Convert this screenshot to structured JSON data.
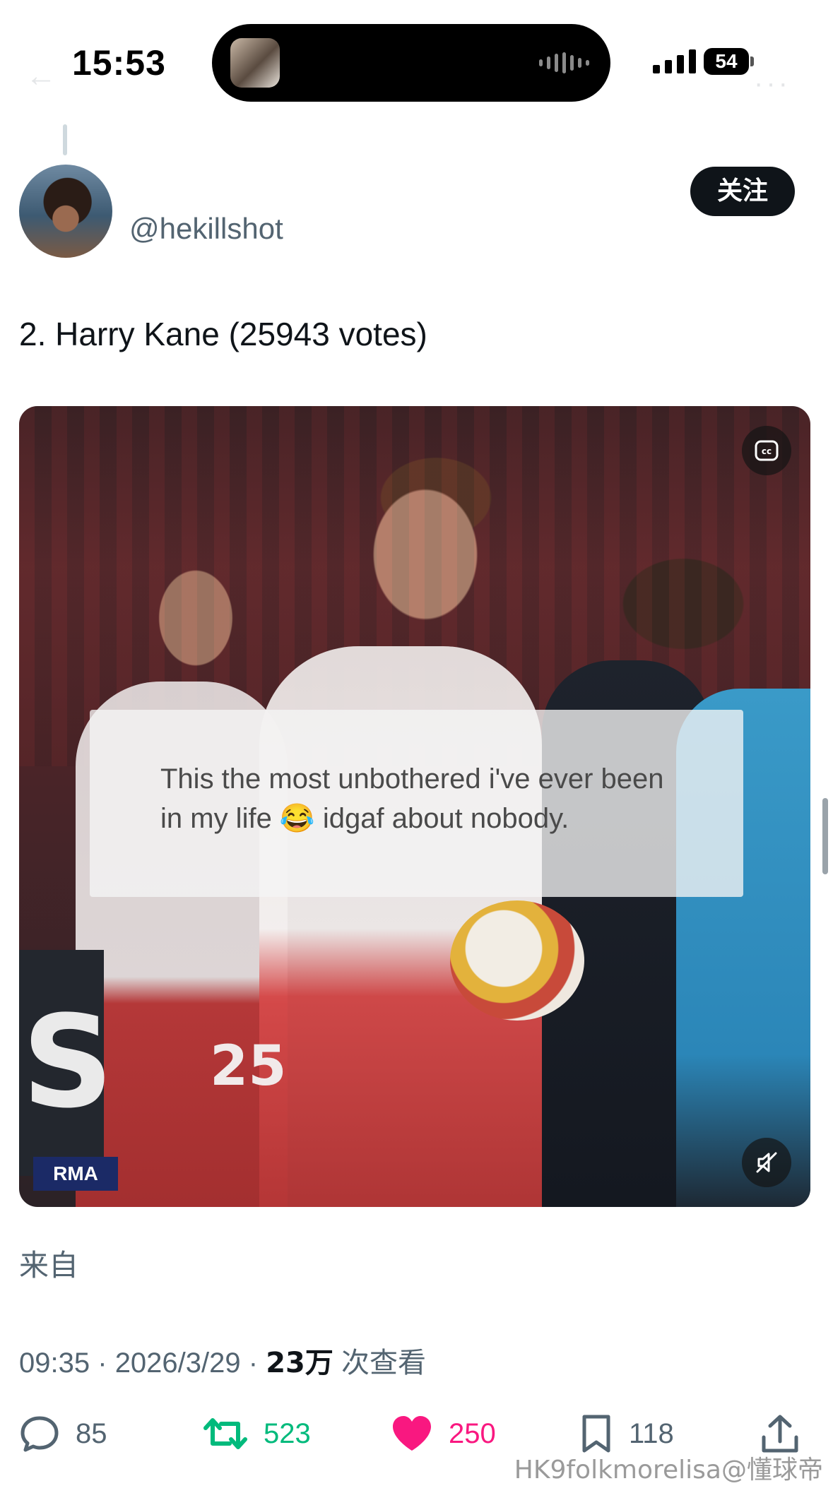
{
  "status_bar": {
    "time": "15:53",
    "battery": "54"
  },
  "author": {
    "handle": "@hekillshot",
    "follow_label": "关注"
  },
  "tweet": {
    "text": "2. Harry Kane (25943 votes)",
    "source_label": "来自"
  },
  "media": {
    "caption_line1": "This the most unbothered i've ever been",
    "caption_line2": "in my life 😂 idgaf about nobody.",
    "shirt_number": "25",
    "scoreboard_team": "RMA",
    "board_letter": "S",
    "cc_icon": "closed-captions-icon",
    "mute_icon": "volume-muted-icon"
  },
  "meta": {
    "time": "09:35",
    "separator": "·",
    "date": "2026/3/29",
    "views_count": "23万",
    "views_label": "次查看"
  },
  "actions": {
    "replies": "85",
    "retweets": "523",
    "likes": "250",
    "bookmarks": "118"
  },
  "colors": {
    "retweet": "#00ba7c",
    "like": "#f91880",
    "muted_text": "#536471",
    "primary_text": "#0f1419"
  },
  "watermark": "HK9folkmorelisa@懂球帝"
}
